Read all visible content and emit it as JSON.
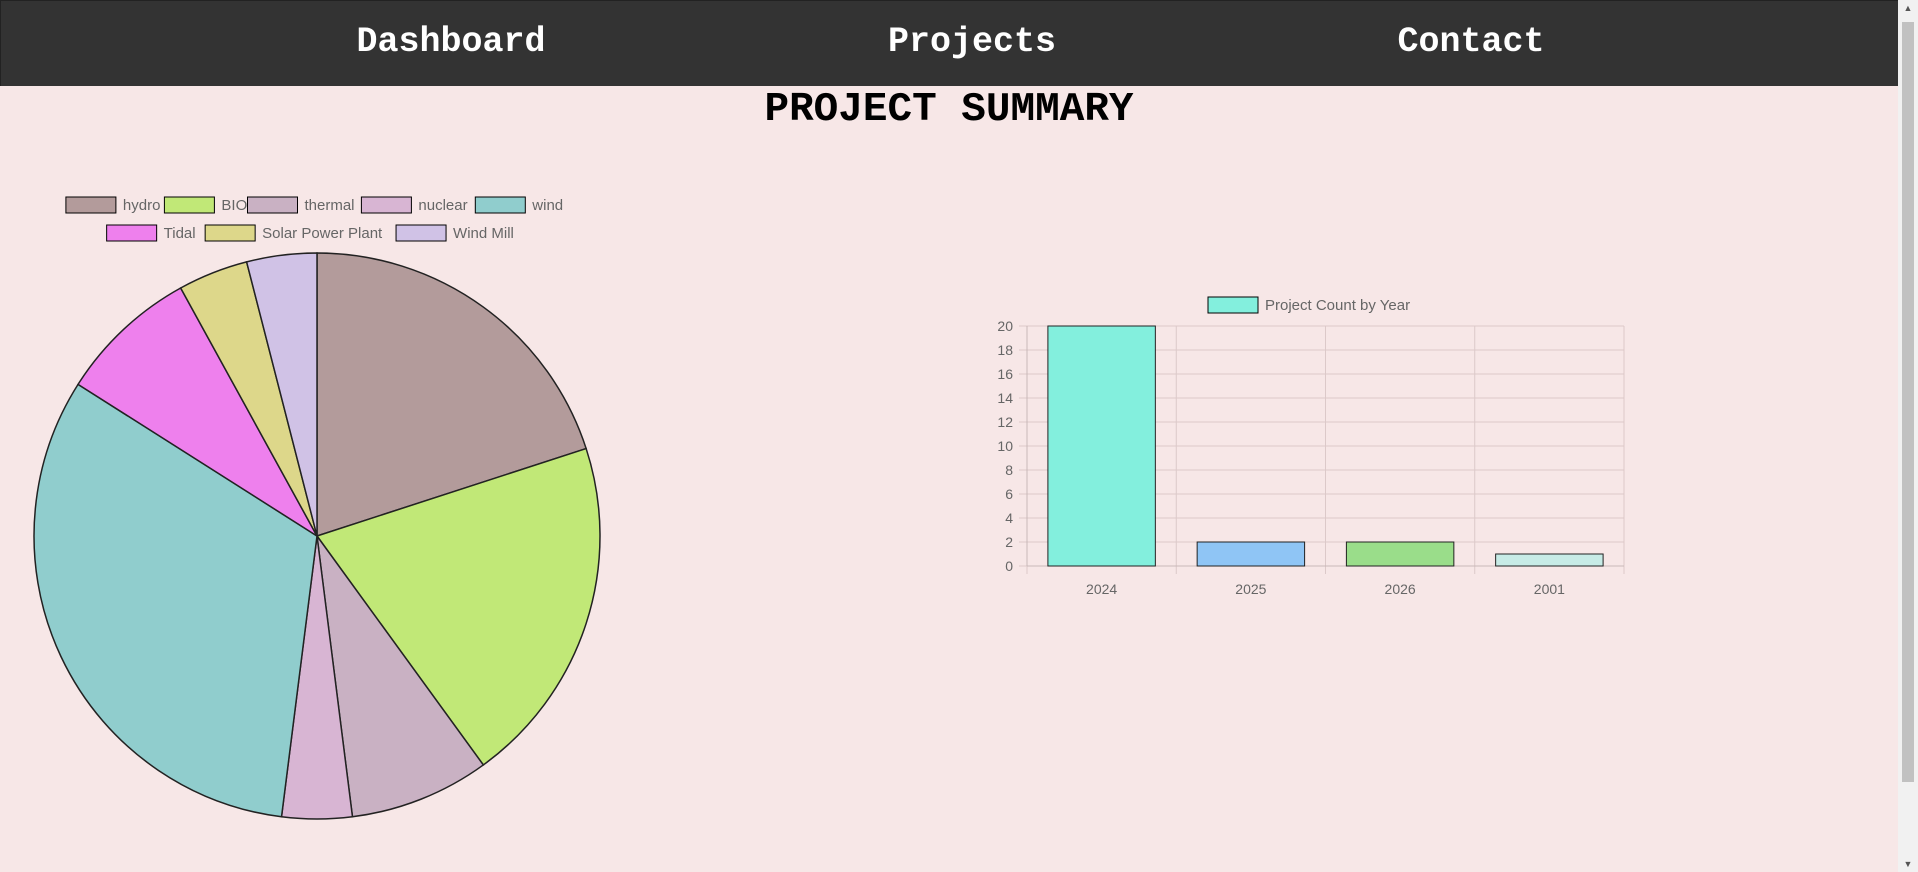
{
  "nav": {
    "items": [
      {
        "label": "Dashboard"
      },
      {
        "label": "Projects"
      },
      {
        "label": "Contact"
      }
    ]
  },
  "page_title": "PROJECT SUMMARY",
  "chart_data": [
    {
      "type": "pie",
      "title": "",
      "legend_position": "top",
      "labels": [
        "hydro",
        "BIO",
        "thermal",
        "nuclear",
        "wind",
        "Tidal",
        "Solar Power Plant",
        "Wind Mill"
      ],
      "values": [
        5,
        5,
        2,
        1,
        8,
        2,
        1,
        1
      ],
      "colors": [
        "#b39b9b",
        "#c1e877",
        "#c9b1c3",
        "#d8b5d3",
        "#90cdcd",
        "#ee80ed",
        "#ddd78a",
        "#d0c2e6"
      ]
    },
    {
      "type": "bar",
      "title": "",
      "legend_position": "top",
      "series": [
        {
          "name": "Project Count by Year",
          "values": [
            20,
            2,
            2,
            1
          ]
        }
      ],
      "categories": [
        "2024",
        "2025",
        "2026",
        "2001"
      ],
      "colors": [
        "#83efdd",
        "#8fc5f5",
        "#9add8a",
        "#c7ebe6"
      ],
      "ylim": [
        0,
        20
      ],
      "yticks": [
        0,
        2,
        4,
        6,
        8,
        10,
        12,
        14,
        16,
        18,
        20
      ],
      "grid": true
    }
  ]
}
